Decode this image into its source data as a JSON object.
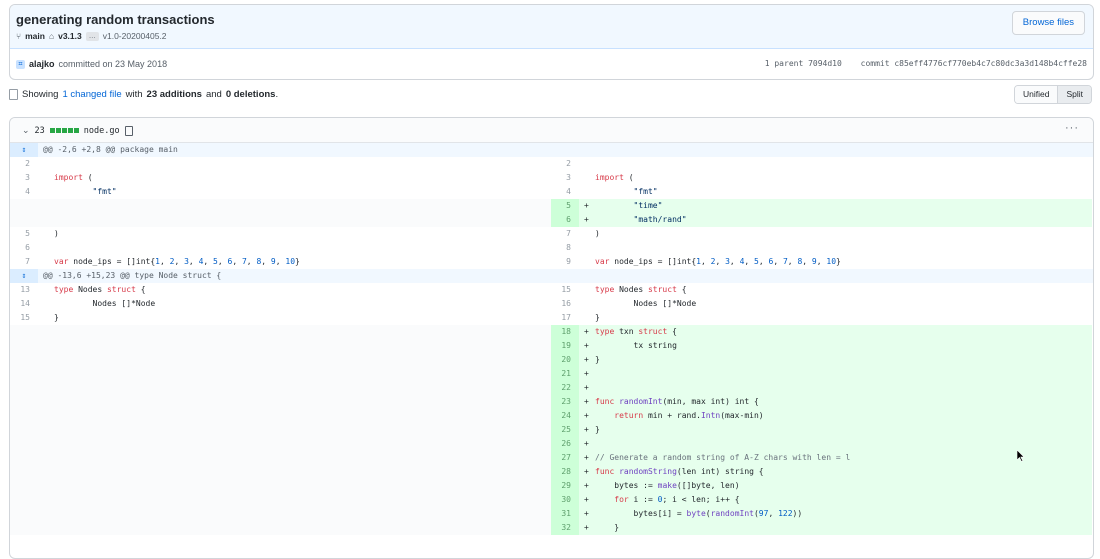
{
  "commit": {
    "title": "generating random transactions",
    "branch": "main",
    "tag": "v3.1.3",
    "ellipsis": "…",
    "older_tag": "v1.0-20200405.2",
    "browse_label": "Browse files",
    "author": "alajko",
    "committed_text": "committed on 23 May 2018",
    "parent_text": "1 parent 7094d10",
    "commit_sha_text": "commit c85eff4776cf770eb4c7c80dc3a3d148b4cffe28"
  },
  "summary": {
    "prefix": "Showing",
    "changed_link": "1 changed file",
    "mid": "with",
    "additions": "23 additions",
    "and": "and",
    "deletions": "0 deletions",
    "suffix": "."
  },
  "view_toggle": {
    "unified": "Unified",
    "split": "Split",
    "active": "Split"
  },
  "file": {
    "count": "23",
    "name": "node.go",
    "kebab": "···"
  },
  "diff_rows": [
    {
      "type": "hunk",
      "text": "@@ -2,6 +2,8 @@ package main"
    },
    {
      "type": "line",
      "ln": "2",
      "lc": "",
      "rn": "2",
      "rc": "",
      "add": false
    },
    {
      "type": "line",
      "ln": "3",
      "lc": "import (",
      "rn": "3",
      "rc": "import (",
      "add": false
    },
    {
      "type": "line",
      "ln": "4",
      "lc": "\t\"fmt\"",
      "rn": "4",
      "rc": "\t\"fmt\"",
      "add": false
    },
    {
      "type": "line",
      "ln": "",
      "lc": null,
      "rn": "5",
      "rc": "\t\"time\"",
      "add": true
    },
    {
      "type": "line",
      "ln": "",
      "lc": null,
      "rn": "6",
      "rc": "\t\"math/rand\"",
      "add": true
    },
    {
      "type": "line",
      "ln": "5",
      "lc": ")",
      "rn": "7",
      "rc": ")",
      "add": false
    },
    {
      "type": "line",
      "ln": "6",
      "lc": "",
      "rn": "8",
      "rc": "",
      "add": false
    },
    {
      "type": "line",
      "ln": "7",
      "lc": "var node_ips = []int{1, 2, 3, 4, 5, 6, 7, 8, 9, 10}",
      "rn": "9",
      "rc": "var node_ips = []int{1, 2, 3, 4, 5, 6, 7, 8, 9, 10}",
      "add": false
    },
    {
      "type": "hunk",
      "text": "@@ -13,6 +15,23 @@ type Node struct {"
    },
    {
      "type": "line",
      "ln": "13",
      "lc": "type Nodes struct {",
      "rn": "15",
      "rc": "type Nodes struct {",
      "add": false
    },
    {
      "type": "line",
      "ln": "14",
      "lc": "\tNodes []*Node",
      "rn": "16",
      "rc": "\tNodes []*Node",
      "add": false
    },
    {
      "type": "line",
      "ln": "15",
      "lc": "}",
      "rn": "17",
      "rc": "}",
      "add": false
    },
    {
      "type": "line",
      "ln": "",
      "lc": null,
      "rn": "18",
      "rc": "type txn struct {",
      "add": true
    },
    {
      "type": "line",
      "ln": "",
      "lc": null,
      "rn": "19",
      "rc": "\ttx string",
      "add": true
    },
    {
      "type": "line",
      "ln": "",
      "lc": null,
      "rn": "20",
      "rc": "}",
      "add": true
    },
    {
      "type": "line",
      "ln": "",
      "lc": null,
      "rn": "21",
      "rc": "",
      "add": true
    },
    {
      "type": "line",
      "ln": "",
      "lc": null,
      "rn": "22",
      "rc": "",
      "add": true
    },
    {
      "type": "line",
      "ln": "",
      "lc": null,
      "rn": "23",
      "rc": "func randomInt(min, max int) int {",
      "add": true
    },
    {
      "type": "line",
      "ln": "",
      "lc": null,
      "rn": "24",
      "rc": "    return min + rand.Intn(max-min)",
      "add": true
    },
    {
      "type": "line",
      "ln": "",
      "lc": null,
      "rn": "25",
      "rc": "}",
      "add": true
    },
    {
      "type": "line",
      "ln": "",
      "lc": null,
      "rn": "26",
      "rc": "",
      "add": true
    },
    {
      "type": "line",
      "ln": "",
      "lc": null,
      "rn": "27",
      "rc": "// Generate a random string of A-Z chars with len = l",
      "add": true
    },
    {
      "type": "line",
      "ln": "",
      "lc": null,
      "rn": "28",
      "rc": "func randomString(len int) string {",
      "add": true
    },
    {
      "type": "line",
      "ln": "",
      "lc": null,
      "rn": "29",
      "rc": "    bytes := make([]byte, len)",
      "add": true
    },
    {
      "type": "line",
      "ln": "",
      "lc": null,
      "rn": "30",
      "rc": "    for i := 0; i < len; i++ {",
      "add": true
    },
    {
      "type": "line",
      "ln": "",
      "lc": null,
      "rn": "31",
      "rc": "        bytes[i] = byte(randomInt(97, 122))",
      "add": true
    },
    {
      "type": "line",
      "ln": "",
      "lc": null,
      "rn": "32",
      "rc": "    }",
      "add": true
    }
  ]
}
